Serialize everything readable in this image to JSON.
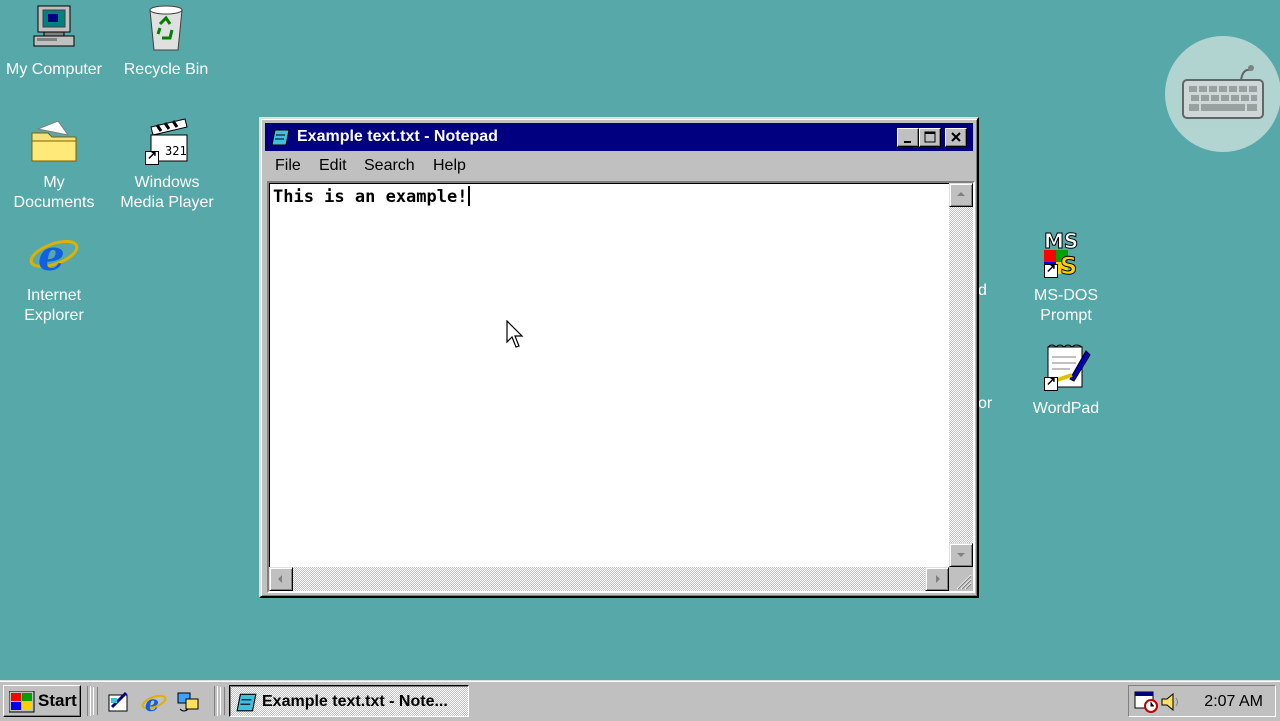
{
  "desktop": {
    "icons_left": [
      {
        "name": "my-computer",
        "label": "My Computer"
      },
      {
        "name": "recycle-bin",
        "label": "Recycle Bin"
      },
      {
        "name": "my-documents",
        "label": "My\nDocuments"
      },
      {
        "name": "windows-media-player",
        "label": "Windows\nMedia Player"
      },
      {
        "name": "internet-explorer",
        "label": "Internet\nExplorer"
      }
    ],
    "icons_right": [
      {
        "name": "ms-dos-prompt",
        "label": "MS-DOS\nPrompt"
      },
      {
        "name": "wordpad",
        "label": "WordPad"
      }
    ],
    "obscured_label_fragments": [
      "d",
      "or"
    ]
  },
  "window": {
    "title": "Example text.txt - Notepad",
    "menu": [
      "File",
      "Edit",
      "Search",
      "Help"
    ],
    "content": "This is an example!"
  },
  "taskbar": {
    "start_label": "Start",
    "task_label": "Example text.txt - Note...",
    "clock": "2:07 AM"
  },
  "colors": {
    "desktop": "#57a8a8",
    "titlebar": "#000080",
    "face": "#c0c0c0"
  }
}
